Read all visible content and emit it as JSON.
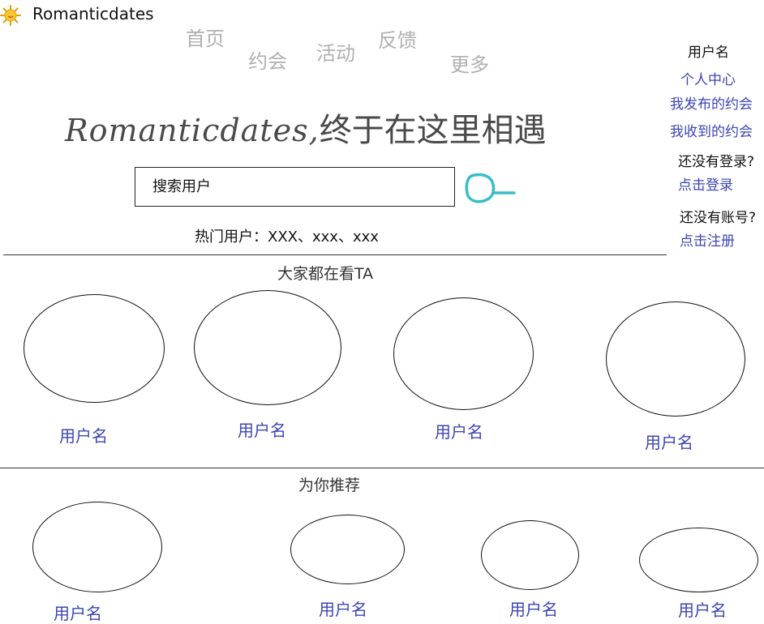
{
  "header": {
    "brand_name": "Romanticdates",
    "logo_icon": "sun-icon"
  },
  "nav": {
    "home": "首页",
    "dates": "约会",
    "activities": "活动",
    "feedback": "反馈",
    "more": "更多"
  },
  "hero": {
    "script_text": "Romanticdates,",
    "cn_text": "终于在这里相遇"
  },
  "search": {
    "placeholder": "搜索用户",
    "icon": "search-icon"
  },
  "hot_users": {
    "label": "热门用户：XXX、xxx、xxx"
  },
  "sidebar": {
    "username": "用户名",
    "profile_link": "个人中心",
    "my_posted_dates": "我发布的约会",
    "my_received_dates": "我收到的约会",
    "not_logged_in": "还没有登录?",
    "login_link": "点击登录",
    "no_account": "还没有账号?",
    "register_link": "点击注册"
  },
  "popular_section": {
    "title": "大家都在看TA",
    "users": [
      {
        "name": "用户名"
      },
      {
        "name": "用户名"
      },
      {
        "name": "用户名"
      },
      {
        "name": "用户名"
      }
    ]
  },
  "recommend_section": {
    "title": "为你推荐",
    "users": [
      {
        "name": "用户名"
      },
      {
        "name": "用户名"
      },
      {
        "name": "用户名"
      },
      {
        "name": "用户名"
      }
    ]
  },
  "colors": {
    "link": "#3c45b4",
    "nav": "#b0b0b0",
    "search_icon_stroke": "#3bbcc8",
    "logo": "#f5b400"
  }
}
